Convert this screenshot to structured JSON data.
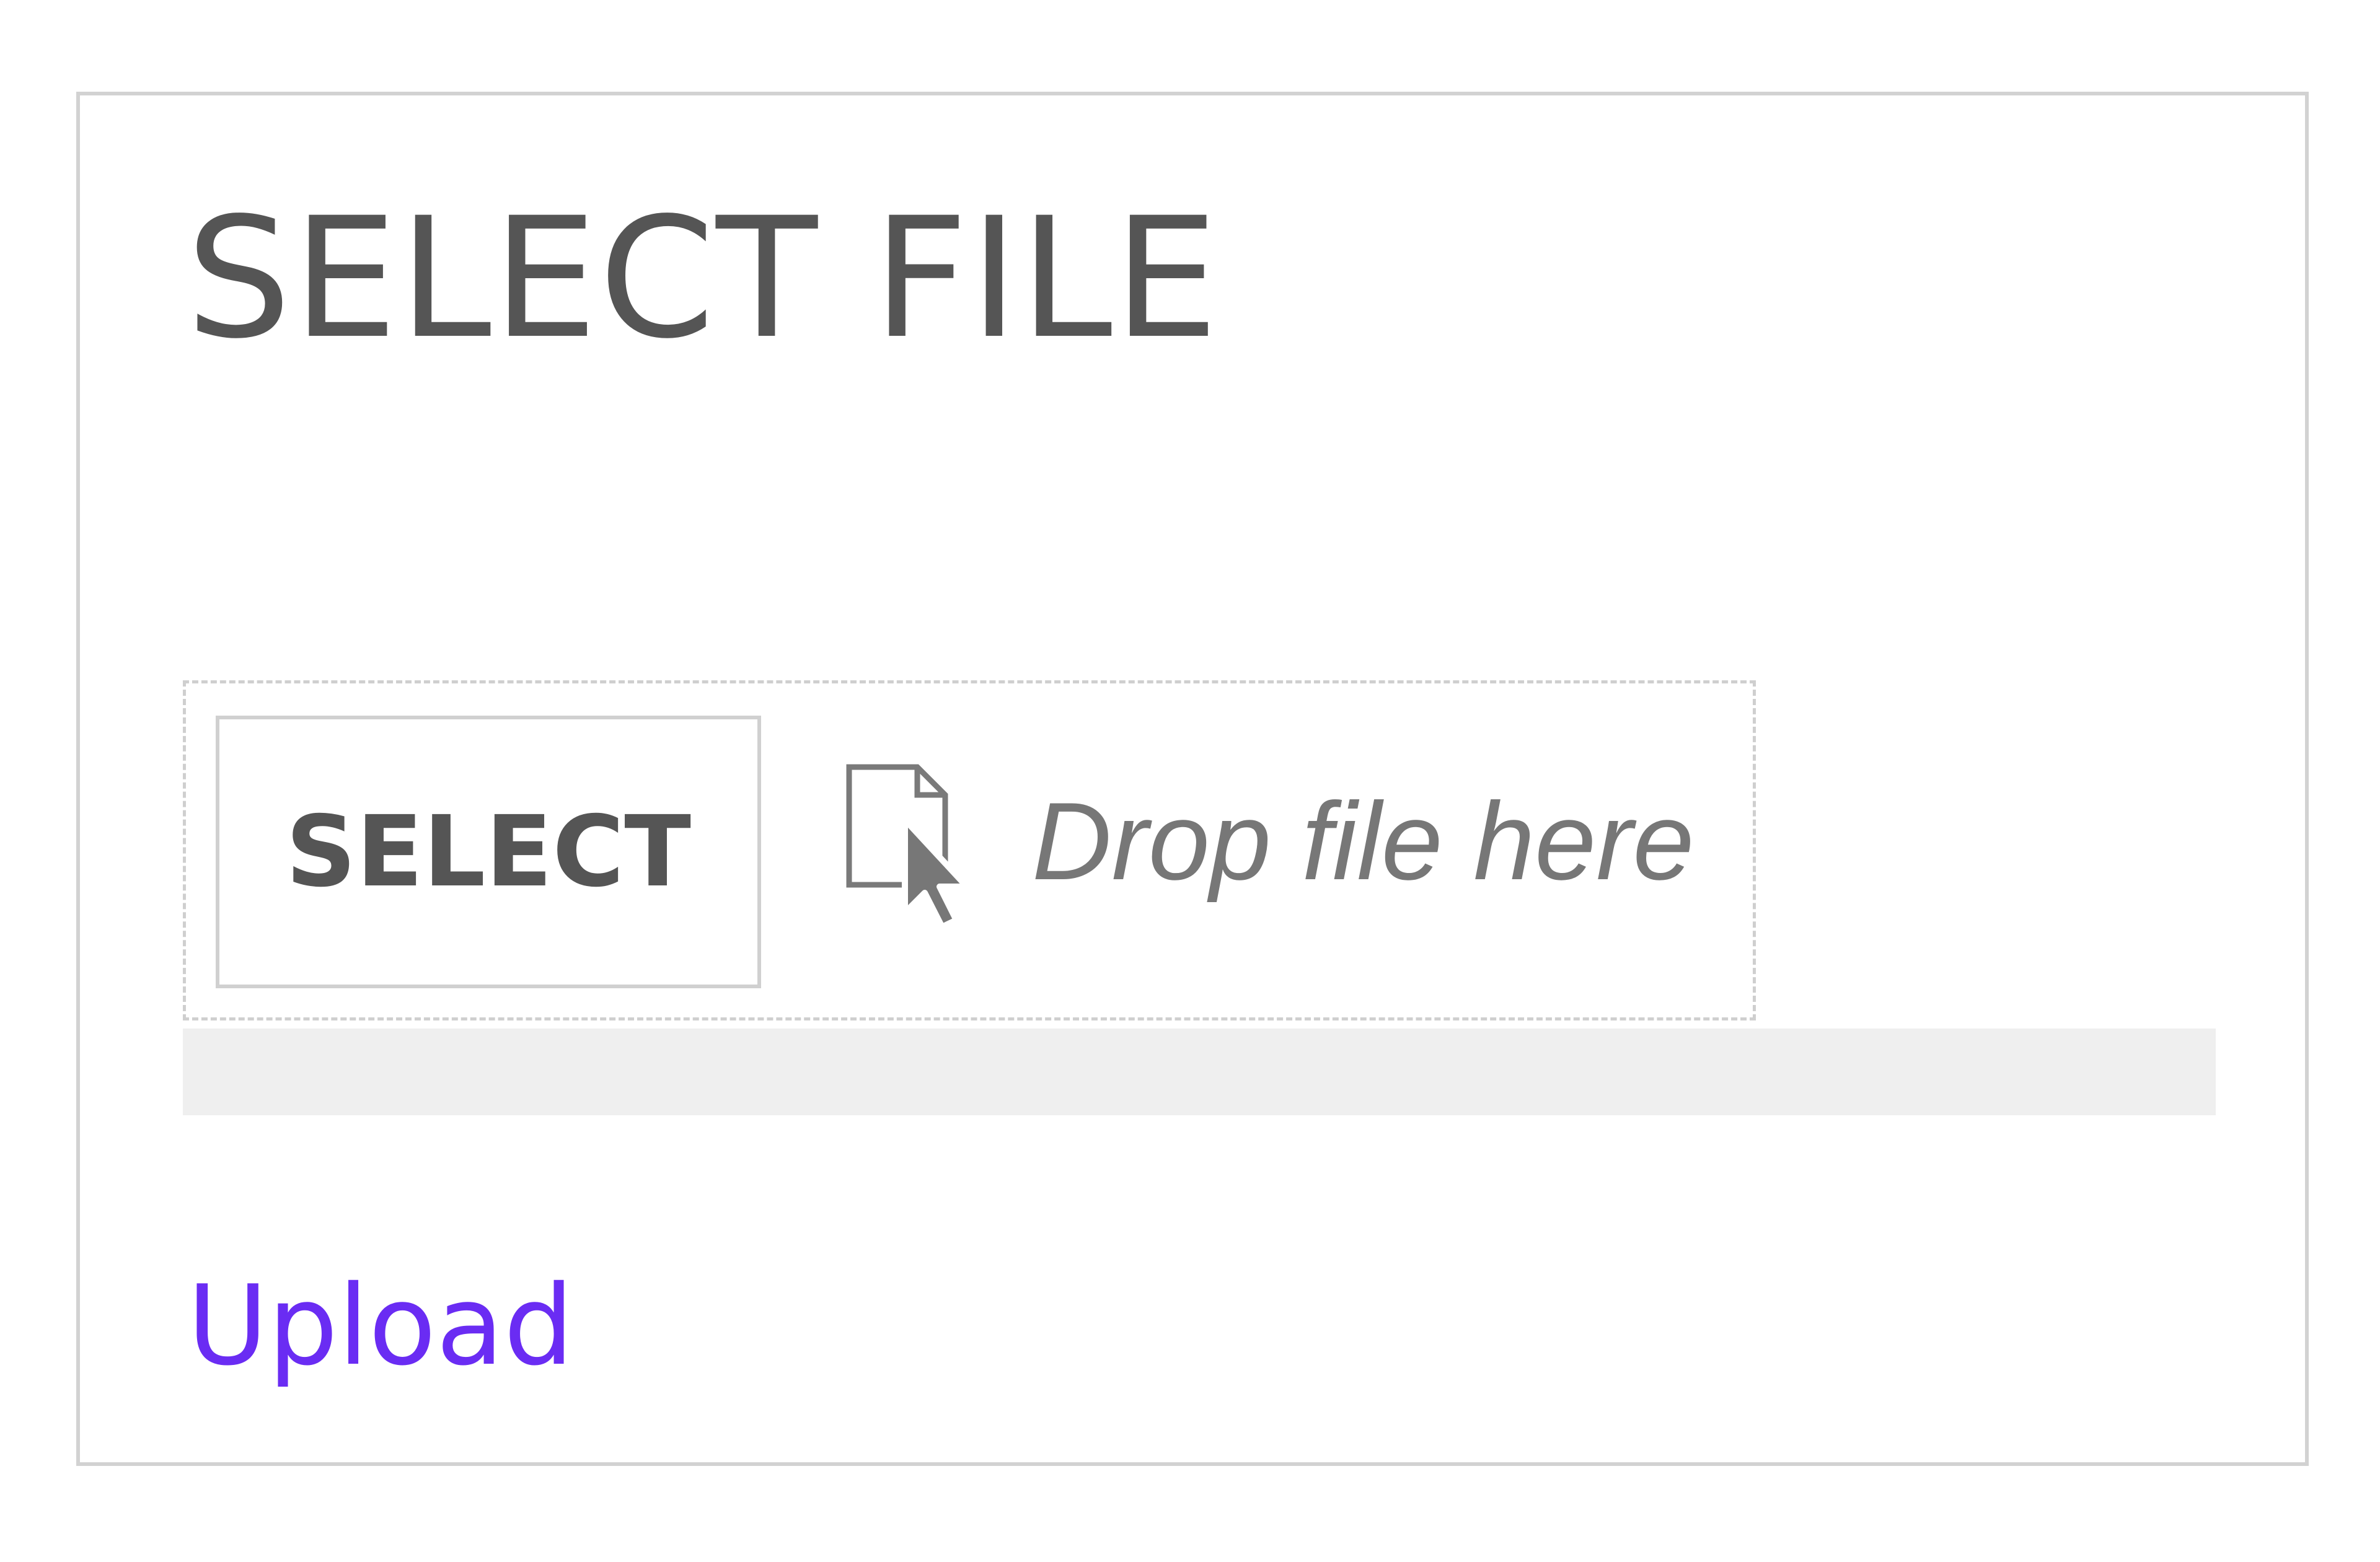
{
  "panel": {
    "title": "SELECT FILE"
  },
  "dropzone": {
    "select_label": "SELECT",
    "drop_text": "Drop file here",
    "icon": "file-with-cursor-icon"
  },
  "progress": {
    "value": 0
  },
  "actions": {
    "upload_label": "Upload",
    "link_color": "#6a2cf3"
  }
}
